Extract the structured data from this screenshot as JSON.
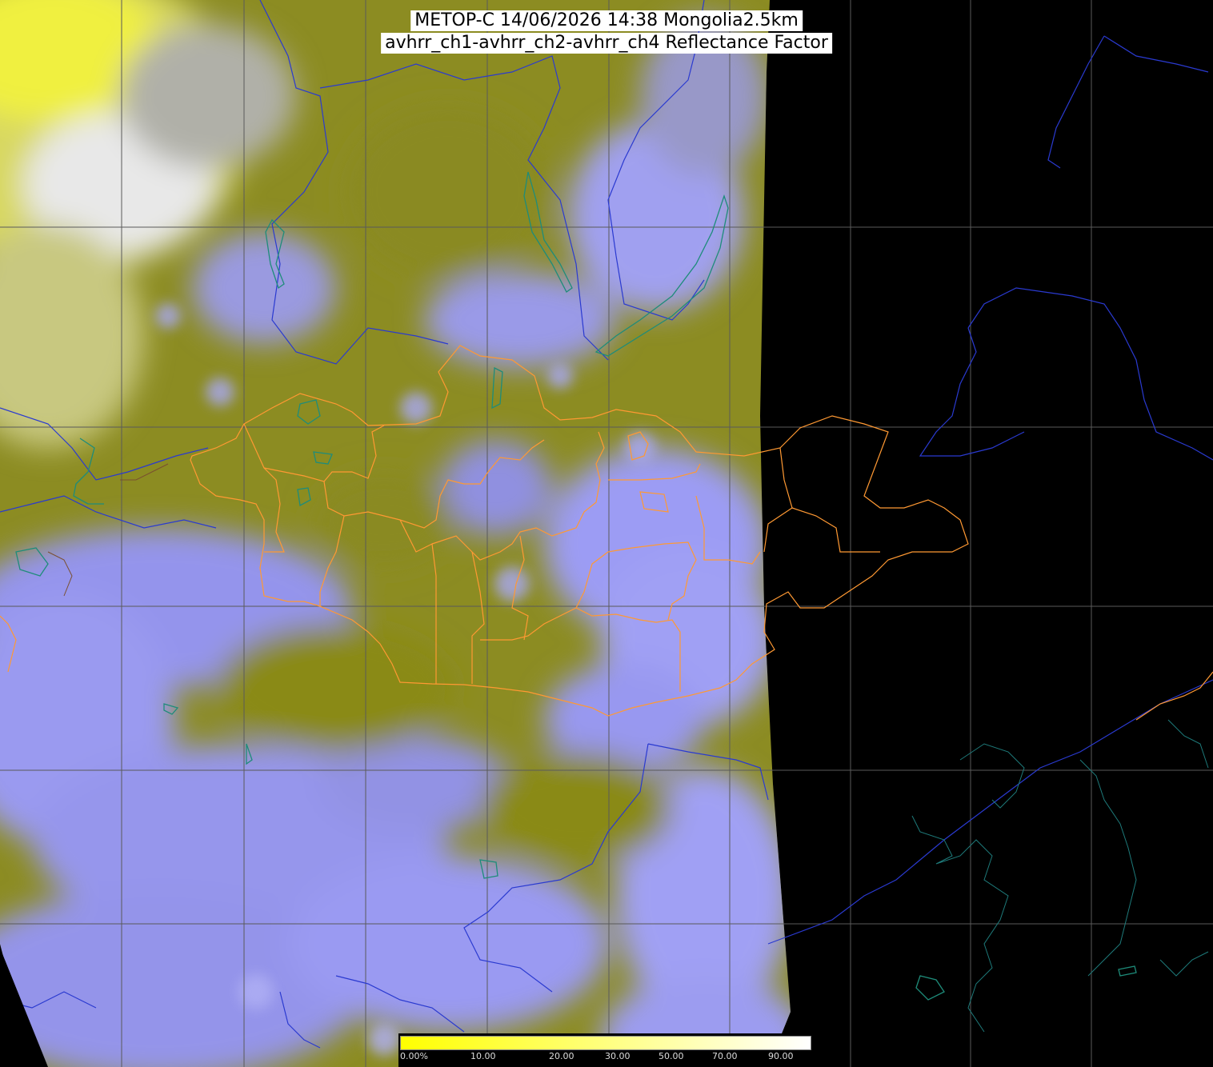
{
  "title": {
    "line1": "METOP-C 14/06/2026 14:38 Mongolia2.5km",
    "line2": "avhrr_ch1-avhrr_ch2-avhrr_ch4 Reflectance Factor"
  },
  "colorbar": {
    "tick_labels": [
      "0.00%",
      "10.00",
      "20.00",
      "30.00",
      "50.00",
      "70.00",
      "90.00"
    ],
    "colors": [
      "#ffff00",
      "#ffff55",
      "#ffffaa",
      "#ffffff"
    ]
  },
  "colors": {
    "background": "#000000",
    "land_clear": "#8c8c1e",
    "cloud": "#8c8cf0",
    "bright_cloud": "#f0f0a0",
    "admin_borders": "#ff9933",
    "coastlines_rivers": "#2233cc",
    "lakes": "#1e8c7a",
    "graticule": "#555555"
  }
}
